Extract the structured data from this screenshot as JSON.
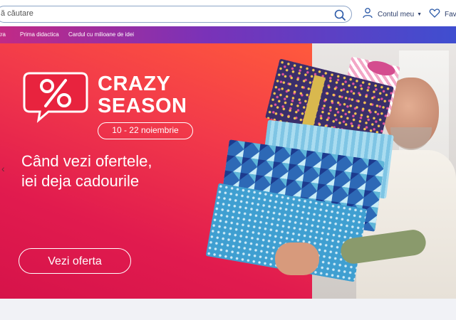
{
  "header": {
    "search_placeholder": "ă căutare",
    "account_label": "Contul meu",
    "favorites_label": "Favo"
  },
  "nav": {
    "items": [
      "rtra",
      "Prima didactica",
      "Cardul cu milioane de idei"
    ]
  },
  "hero": {
    "badge_symbol": "%",
    "title": "CRAZY\nSEASON",
    "title_line1": "CRAZY",
    "title_line2": "SEASON",
    "dates": "10 - 22 noiembrie",
    "headline_line1": "Când vezi ofertele,",
    "headline_line2": "iei deja cadourile",
    "cta_label": "Vezi oferta",
    "prev_arrow": "‹"
  },
  "colors": {
    "brand_blue": "#2c3e6b",
    "hero_red": "#e11b4e",
    "nav_start": "#c12a86",
    "nav_end": "#3f4ed0"
  },
  "icons": [
    "search-icon",
    "user-icon",
    "chevron-down-icon",
    "heart-icon",
    "percent-badge-icon",
    "chevron-left-icon"
  ]
}
